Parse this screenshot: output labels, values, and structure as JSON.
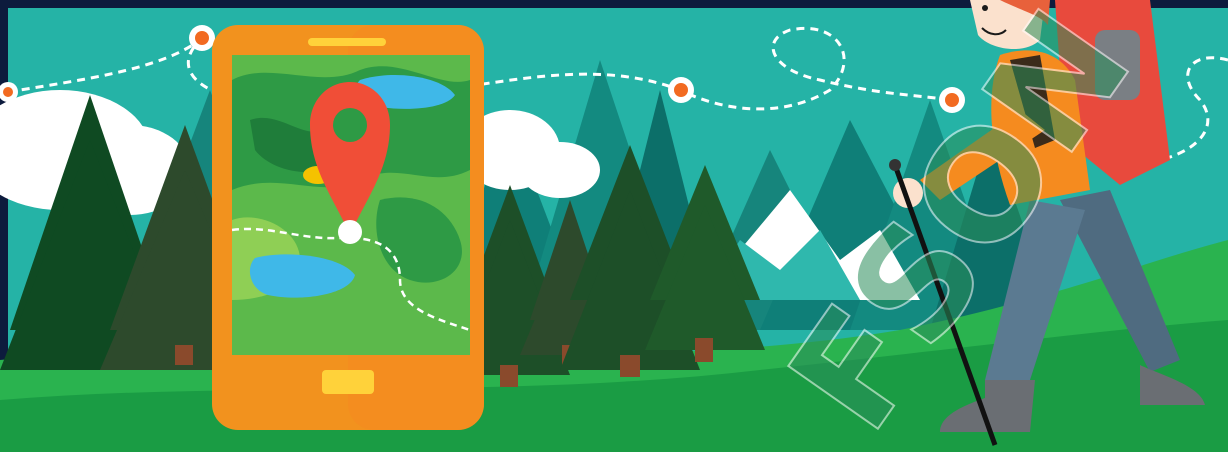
{
  "illustration": {
    "subject": "hiker-with-phone-map",
    "colors": {
      "frame": "#0d1b3d",
      "sky": "#25b3a6",
      "mountain": "#0f7f78",
      "snow": "#ffffff",
      "grass": "#1faa4a",
      "tree": "#1f5a2a",
      "phone": "#f2921e",
      "pin": "#f04e37",
      "route_dot": "#f26a21",
      "backpack": "#e84a3d",
      "shirt": "#f58b1f",
      "pants": "#5b7a91",
      "watermark": "#2a8e5a"
    },
    "watermark_text": "FSON"
  }
}
